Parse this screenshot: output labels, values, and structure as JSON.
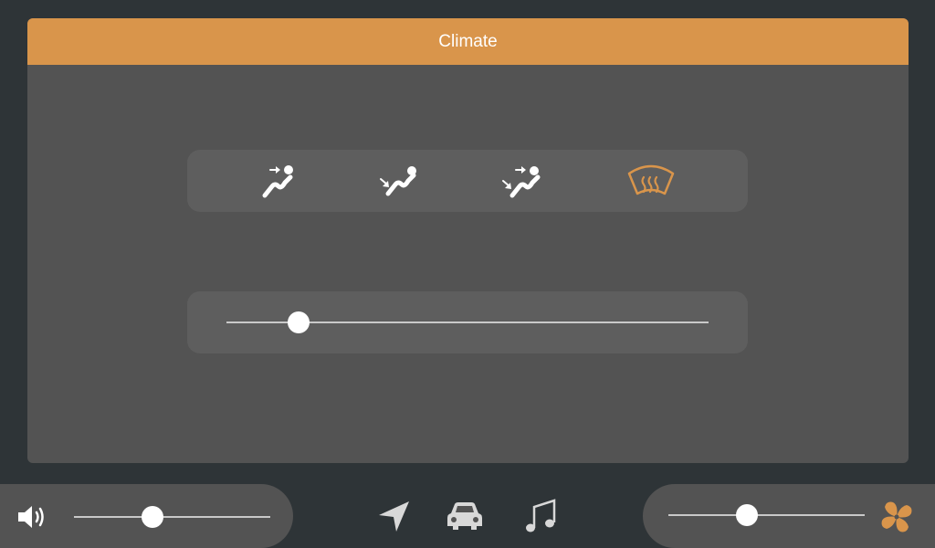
{
  "climate": {
    "title": "Climate",
    "modes": [
      {
        "icon": "airflow-face-icon",
        "active": false
      },
      {
        "icon": "airflow-feet-icon",
        "active": false
      },
      {
        "icon": "airflow-face-feet-icon",
        "active": false
      },
      {
        "icon": "windshield-defrost-icon",
        "active": true
      }
    ],
    "temperature_level": 0.15
  },
  "bottom_bar": {
    "volume_level": 0.4,
    "fan_level": 0.4,
    "nav_icons": [
      "navigation-icon",
      "car-icon",
      "music-icon"
    ]
  },
  "colors": {
    "accent": "#d9954b",
    "background": "#2e3437",
    "panel": "#535353",
    "inset": "#5e5e5e"
  }
}
